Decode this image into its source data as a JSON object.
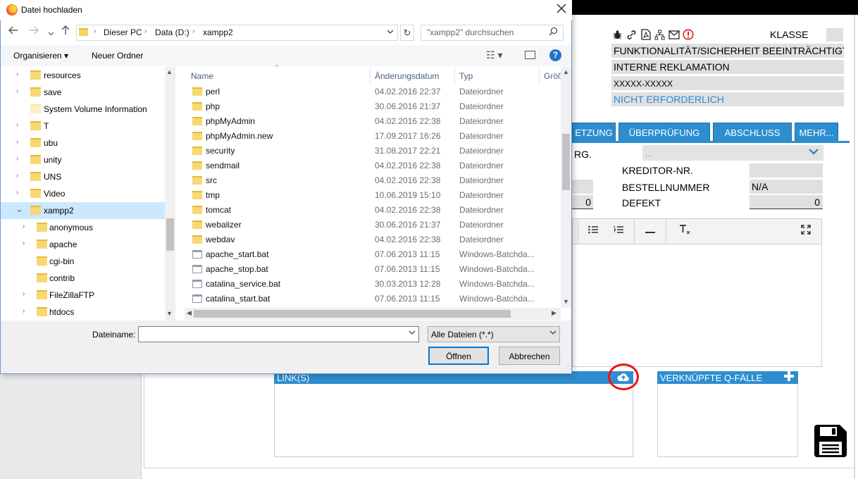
{
  "dialog": {
    "title": "Datei hochladen",
    "address": {
      "crumbs": [
        "Dieser PC",
        "Data (D:)",
        "xampp2"
      ],
      "separator": "›"
    },
    "search_placeholder": "\"xampp2\" durchsuchen",
    "toolbar": {
      "organize": "Organisieren ▾",
      "new_folder": "Neuer Ordner"
    },
    "tree": [
      {
        "label": "resources",
        "chev": "›"
      },
      {
        "label": "save",
        "chev": "›"
      },
      {
        "label": "System Volume Information",
        "chev": ""
      },
      {
        "label": "T",
        "chev": "›"
      },
      {
        "label": "ubu",
        "chev": "›"
      },
      {
        "label": "unity",
        "chev": "›"
      },
      {
        "label": "UNS",
        "chev": "›"
      },
      {
        "label": "Video",
        "chev": "›"
      },
      {
        "label": "xampp2",
        "chev": "⌄"
      },
      {
        "label": "anonymous",
        "chev": "›"
      },
      {
        "label": "apache",
        "chev": "›"
      },
      {
        "label": "cgi-bin",
        "chev": ""
      },
      {
        "label": "contrib",
        "chev": ""
      },
      {
        "label": "FileZillaFTP",
        "chev": "›"
      },
      {
        "label": "htdocs",
        "chev": "›"
      }
    ],
    "columns": {
      "name": "Name",
      "date": "Änderungsdatum",
      "type": "Typ",
      "size": "Größe"
    },
    "files": [
      {
        "name": "perl",
        "date": "04.02.2016 22:37",
        "type": "Dateiordner",
        "kind": "folder"
      },
      {
        "name": "php",
        "date": "30.06.2016 21:37",
        "type": "Dateiordner",
        "kind": "folder"
      },
      {
        "name": "phpMyAdmin",
        "date": "04.02.2016 22:38",
        "type": "Dateiordner",
        "kind": "folder"
      },
      {
        "name": "phpMyAdmin.new",
        "date": "17.09.2017 16:26",
        "type": "Dateiordner",
        "kind": "folder"
      },
      {
        "name": "security",
        "date": "31.08.2017 22:21",
        "type": "Dateiordner",
        "kind": "folder"
      },
      {
        "name": "sendmail",
        "date": "04.02.2016 22:38",
        "type": "Dateiordner",
        "kind": "folder"
      },
      {
        "name": "src",
        "date": "04.02.2016 22:38",
        "type": "Dateiordner",
        "kind": "folder"
      },
      {
        "name": "tmp",
        "date": "10.06.2019 15:10",
        "type": "Dateiordner",
        "kind": "folder"
      },
      {
        "name": "tomcat",
        "date": "04.02.2016 22:38",
        "type": "Dateiordner",
        "kind": "folder"
      },
      {
        "name": "webalizer",
        "date": "30.06.2016 21:37",
        "type": "Dateiordner",
        "kind": "folder"
      },
      {
        "name": "webdav",
        "date": "04.02.2016 22:38",
        "type": "Dateiordner",
        "kind": "folder"
      },
      {
        "name": "apache_start.bat",
        "date": "07.06.2013 11:15",
        "type": "Windows-Batchda...",
        "kind": "bat"
      },
      {
        "name": "apache_stop.bat",
        "date": "07.06.2013 11:15",
        "type": "Windows-Batchda...",
        "kind": "bat"
      },
      {
        "name": "catalina_service.bat",
        "date": "30.03.2013 12:28",
        "type": "Windows-Batchda...",
        "kind": "bat"
      },
      {
        "name": "catalina_start.bat",
        "date": "07.06.2013 11:15",
        "type": "Windows-Batchda...",
        "kind": "bat"
      }
    ],
    "filename_label": "Dateiname:",
    "filename_value": "",
    "filter": "Alle Dateien (*.*)",
    "open_button": "Öffnen",
    "cancel_button": "Abbrechen"
  },
  "app": {
    "klasse": "KLASSE",
    "fields": [
      "FUNKTIONALITÄT/SICHERHEIT BEEINTRÄCHTIGT",
      "INTERNE REKLAMATION",
      "XXXXX-XXXXX",
      "NICHT ERFORDERLICH"
    ],
    "tabs": [
      "ETZUNG",
      "ÜBERPRÜFUNG",
      "ABSCHLUSS",
      "MEHR..."
    ],
    "rg_label": "RG.",
    "dropdown_value": "...",
    "kreditor_label": "KREDITOR-NR.",
    "bestell_label": "BESTELLNUMMER",
    "bestell_value": "N/A",
    "defekt_label": "DEFEKT",
    "defekt_value": "0",
    "left_value": "0",
    "links_title": "LINK(S)",
    "qfaelle_title": "VERKNÜPFTE Q-FÄLLE",
    "accent_color": "#2d8ecf"
  }
}
